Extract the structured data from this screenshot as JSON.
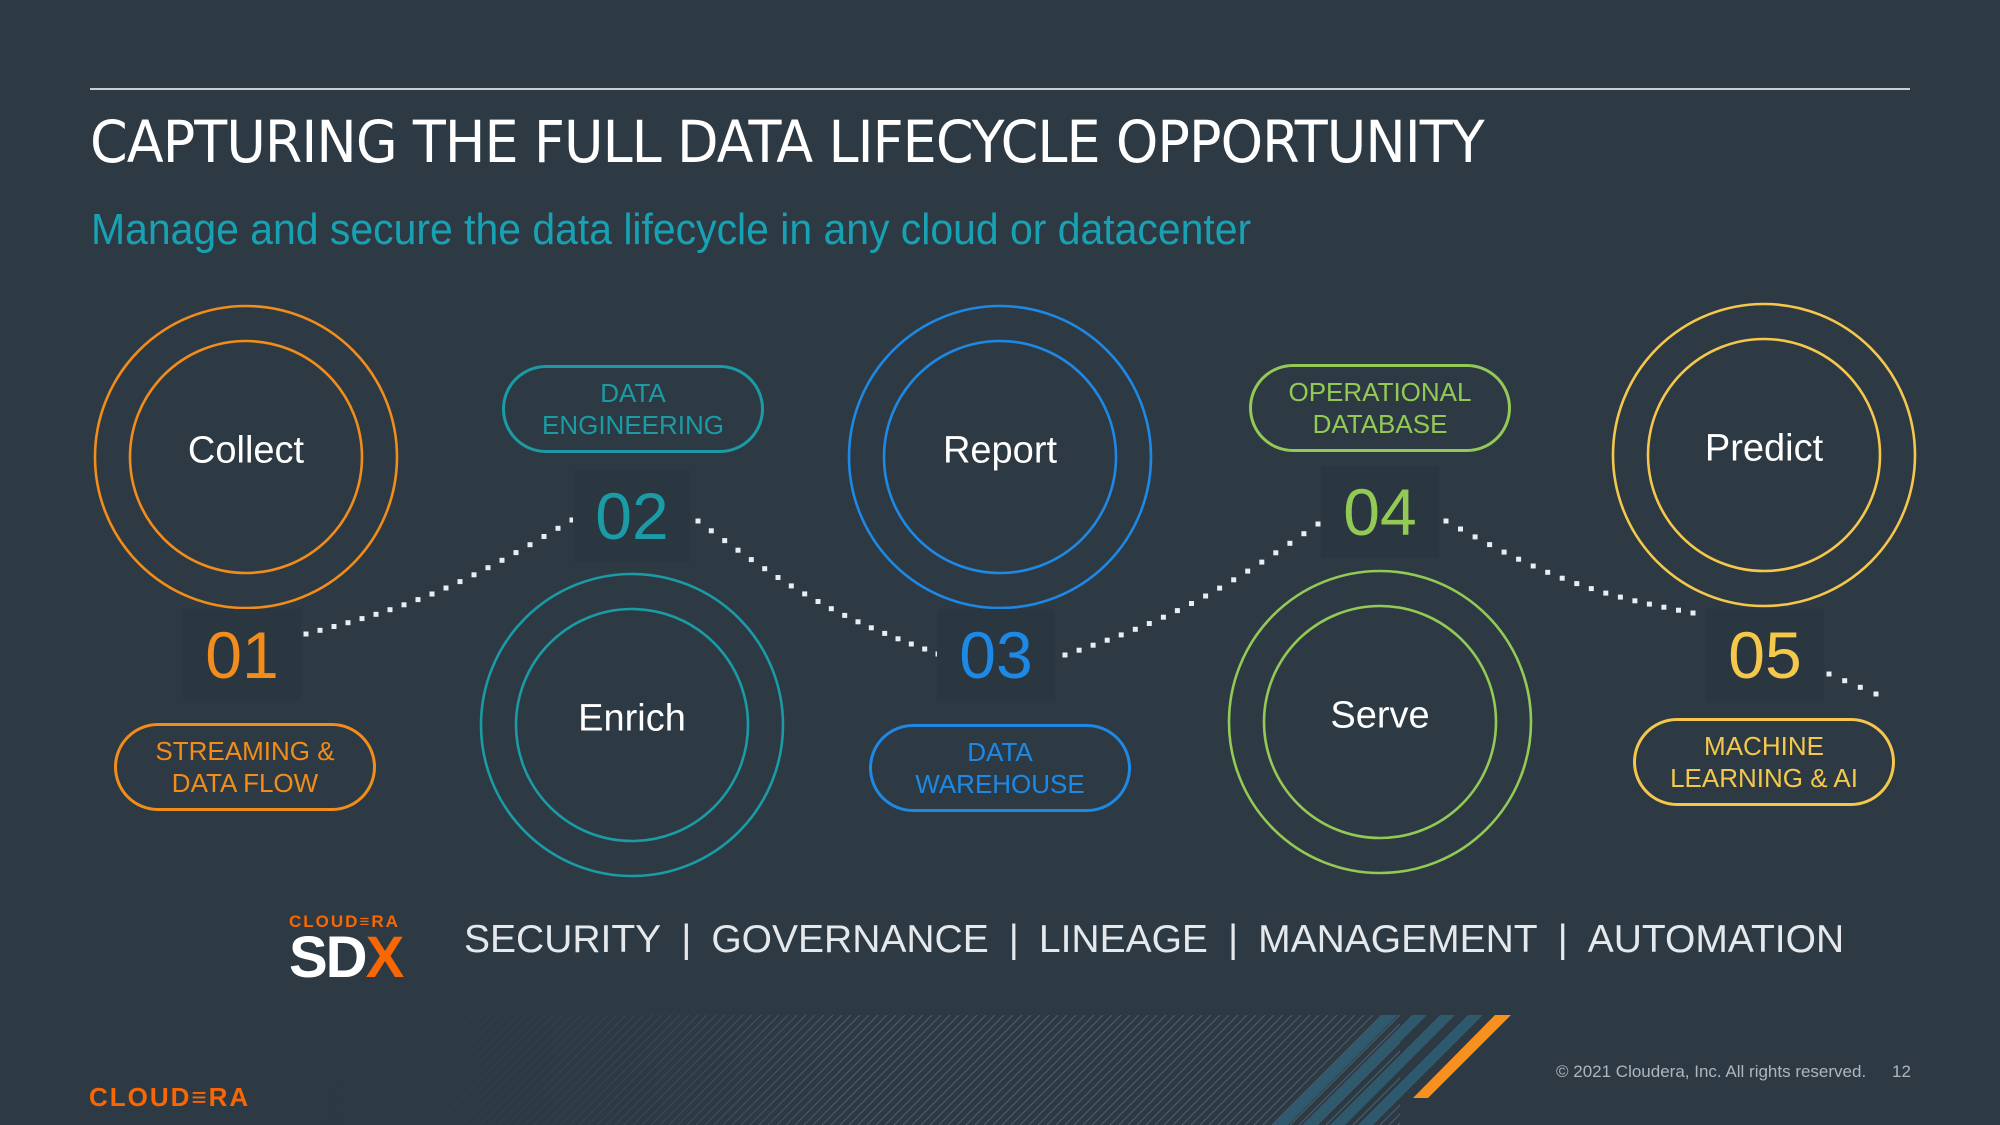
{
  "slide": {
    "title": "CAPTURING THE FULL DATA LIFECYCLE OPPORTUNITY",
    "subtitle": "Manage and secure the data lifecycle in any cloud or datacenter"
  },
  "colors": {
    "background": "#2d3a44",
    "subtitle": "#17a2b3",
    "brand_orange": "#f96702"
  },
  "stages": [
    {
      "number": "01",
      "name": "Collect",
      "service_lines": [
        "STREAMING &",
        "DATA FLOW"
      ],
      "color": "#f28c1a"
    },
    {
      "number": "02",
      "name": "Enrich",
      "service_lines": [
        "DATA",
        "ENGINEERING"
      ],
      "color": "#1a9ba6"
    },
    {
      "number": "03",
      "name": "Report",
      "service_lines": [
        "DATA",
        "WAREHOUSE"
      ],
      "color": "#1e88e5"
    },
    {
      "number": "04",
      "name": "Serve",
      "service_lines": [
        "OPERATIONAL",
        "DATABASE"
      ],
      "color": "#93c955"
    },
    {
      "number": "05",
      "name": "Predict",
      "service_lines": [
        "MACHINE",
        "LEARNING & AI"
      ],
      "color": "#f5c84c"
    }
  ],
  "sdx": {
    "brand": "CLOUD≡RA",
    "word_main": "SD",
    "word_accent": "X",
    "pillars": [
      "SECURITY",
      "GOVERNANCE",
      "LINEAGE",
      "MANAGEMENT",
      "AUTOMATION"
    ],
    "separator": "|"
  },
  "footer": {
    "logo": "CLOUD≡RA",
    "copyright": "© 2021 Cloudera, Inc. All rights reserved.",
    "page_number": "12"
  }
}
